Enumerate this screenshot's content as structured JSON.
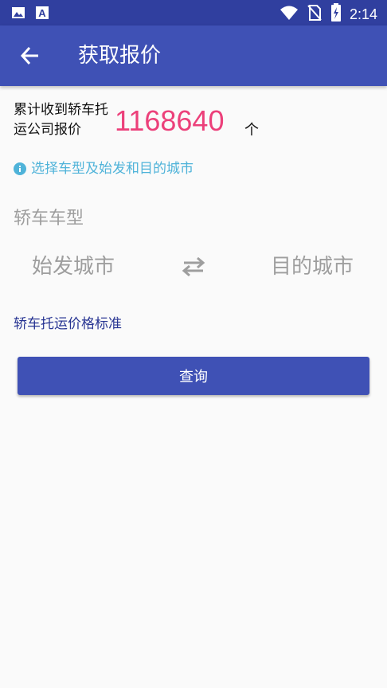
{
  "status_bar": {
    "time": "2:14",
    "left_icons": [
      "image-icon",
      "text-a-icon"
    ],
    "right_icons": [
      "wifi-icon",
      "no-sim-icon",
      "battery-charging-icon"
    ]
  },
  "app_bar": {
    "title": "获取报价",
    "back_icon": "arrow-left-icon",
    "color": "#3f51b5"
  },
  "counter": {
    "label": "累计收到轿车托运公司报价",
    "value": "1168640",
    "unit": "个",
    "value_color": "#ec407a"
  },
  "hint": {
    "icon": "info-icon",
    "text": "选择车型及始发和目的城市",
    "color": "#4fb3d9"
  },
  "form": {
    "car_type": "轿车车型",
    "from_city": "始发城市",
    "to_city": "目的城市",
    "swap_icon": "swap-arrows-icon"
  },
  "links": {
    "price_standard": "轿车托运价格标准"
  },
  "actions": {
    "query_label": "查询"
  }
}
